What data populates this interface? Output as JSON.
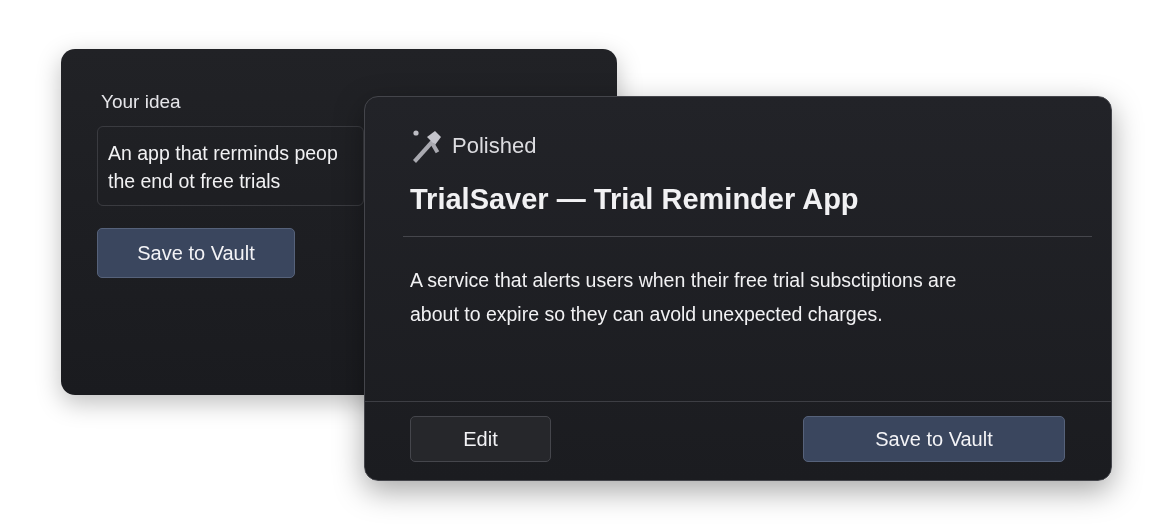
{
  "idea_card": {
    "label": "Your idea",
    "field_lines": [
      "An app that rerminds peop",
      "the end ot free trials"
    ],
    "button": "Save to Vault"
  },
  "result_card": {
    "badge": "Polished",
    "title": "TrialSaver — Trial Reminder App",
    "description": "A service that alerts users when their free trial subsctiptions are about to expire so they can avold unexpected charges.",
    "buttons": [
      {
        "label": "Edit",
        "kind": "secondary"
      },
      {
        "label": "Save to Vault",
        "kind": "primary"
      }
    ]
  }
}
